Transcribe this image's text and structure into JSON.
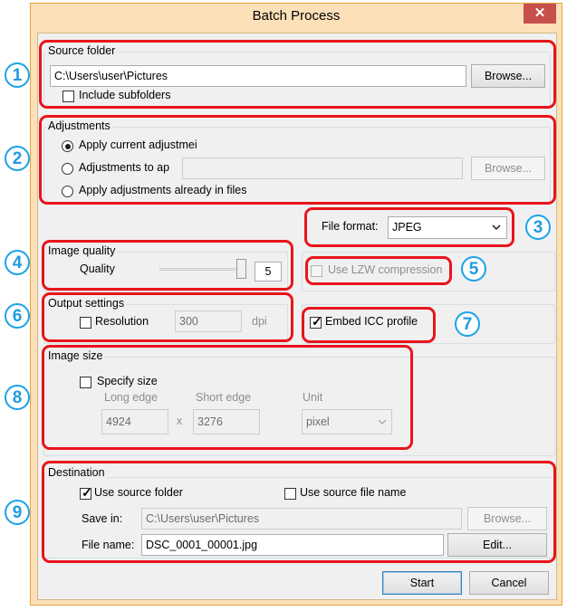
{
  "window": {
    "title": "Batch Process",
    "close_glyph": "✕"
  },
  "callouts": [
    "1",
    "2",
    "3",
    "4",
    "5",
    "6",
    "7",
    "8",
    "9"
  ],
  "source": {
    "group_label": "Source folder",
    "path": "C:\\Users\\user\\Pictures",
    "browse_label": "Browse...",
    "include_subfolders_label": "Include subfolders",
    "include_subfolders_checked": false
  },
  "adjustments": {
    "group_label": "Adjustments",
    "option_current": "Apply current adjustmei",
    "option_to": "Adjustments to ap",
    "option_files": "Apply adjustments already in files",
    "selected": "option_current",
    "browse_label": "Browse..."
  },
  "file_format": {
    "label": "File format:",
    "value": "JPEG",
    "icon": "chevron-down-icon"
  },
  "image_quality": {
    "group_label": "Image quality",
    "quality_label": "Quality",
    "quality_value": "5",
    "slider_level": 1.0
  },
  "lzw": {
    "label": "Use LZW compression",
    "checked": false,
    "enabled": false
  },
  "output": {
    "group_label": "Output settings",
    "resolution_label": "Resolution",
    "resolution_value": "300",
    "unit": "dpi",
    "resolution_checked": false
  },
  "icc": {
    "label": "Embed ICC profile",
    "checked": true
  },
  "image_size": {
    "group_label": "Image size",
    "specify_label": "Specify size",
    "specify_checked": false,
    "long_edge_label": "Long edge",
    "long_edge_value": "4924",
    "times": "x",
    "short_edge_label": "Short edge",
    "short_edge_value": "3276",
    "unit_label": "Unit",
    "unit_value": "pixel"
  },
  "destination": {
    "group_label": "Destination",
    "use_source_folder_label": "Use source folder",
    "use_source_folder_checked": true,
    "use_source_name_label": "Use source file name",
    "use_source_name_checked": false,
    "save_in_label": "Save in:",
    "save_in_value": "C:\\Users\\user\\Pictures",
    "browse_label": "Browse...",
    "file_name_label": "File name:",
    "file_name_value": "DSC_0001_00001.jpg",
    "edit_label": "Edit..."
  },
  "footer": {
    "start_label": "Start",
    "cancel_label": "Cancel"
  },
  "colors": {
    "callout_red": "#e8141b",
    "callout_blue": "#1aa3e8",
    "close_red": "#c7504c"
  }
}
